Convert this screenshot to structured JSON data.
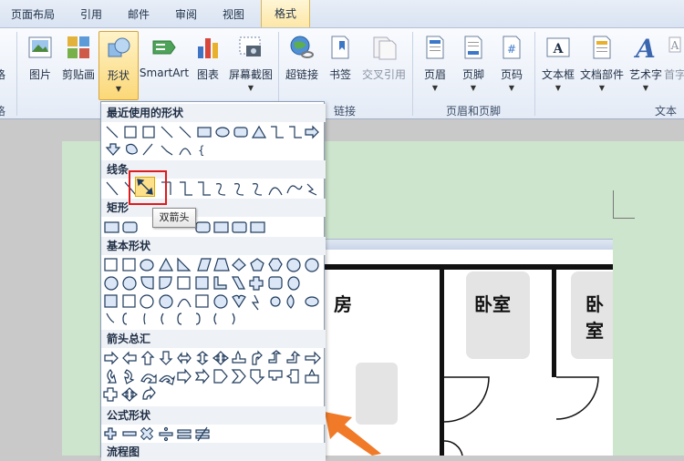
{
  "tabs": [
    "页面布局",
    "引用",
    "邮件",
    "审阅",
    "视图",
    "格式"
  ],
  "ribbon": {
    "left_cut_label": "格",
    "buttons": {
      "picture": "图片",
      "clipart": "剪贴画",
      "shapes": "形状",
      "smartart": "SmartArt",
      "chart": "图表",
      "screenshot": "屏幕截图",
      "hyperlink": "超链接",
      "bookmark": "书签",
      "crossref": "交叉引用",
      "header": "页眉",
      "footer": "页脚",
      "pagenum": "页码",
      "textbox": "文本框",
      "docparts": "文档部件",
      "wordart": "艺术字",
      "dropcap": "首字"
    },
    "groups": {
      "links": "链接",
      "header_footer": "页眉和页脚",
      "text": "文本"
    }
  },
  "dropdown": {
    "sections": {
      "recent": "最近使用的形状",
      "lines": "线条",
      "rectangles": "矩形",
      "basic": "基本形状",
      "arrows": "箭头总汇",
      "equation": "公式形状",
      "flowchart": "流程图"
    },
    "tooltip": "双箭头"
  },
  "floor_plan": {
    "rooms": [
      "房",
      "卧室",
      "卧室"
    ]
  },
  "colors": {
    "accent_highlight": "#e01b1b",
    "selected_bg": "#fbd878",
    "page_bg": "#cde4cd",
    "arrow_orange": "#f07a28"
  }
}
